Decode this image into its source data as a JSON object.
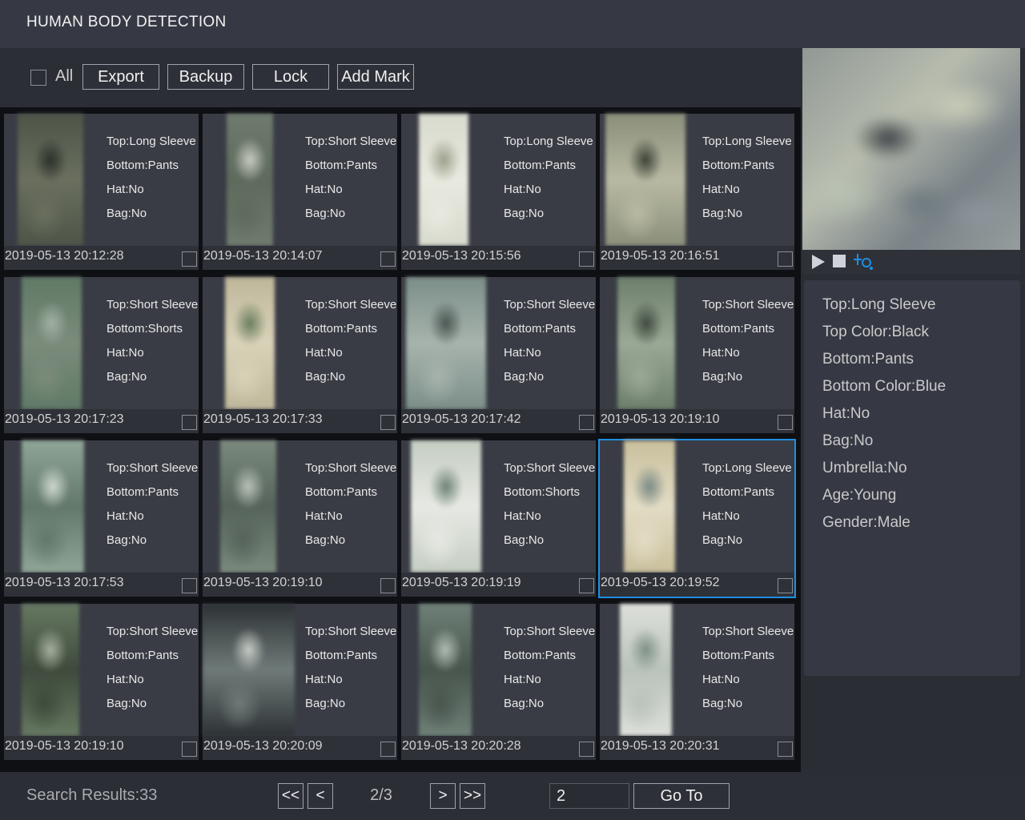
{
  "title": "HUMAN BODY DETECTION",
  "toolbar": {
    "all_label": "All",
    "export_label": "Export",
    "backup_label": "Backup",
    "lock_label": "Lock",
    "add_mark_label": "Add Mark"
  },
  "results": [
    {
      "top": "Top:Long Sleeve",
      "bottom": "Bottom:Pants",
      "hat": "Hat:No",
      "bag": "Bag:No",
      "time": "2019-05-13 20:12:28"
    },
    {
      "top": "Top:Short Sleeve",
      "bottom": "Bottom:Pants",
      "hat": "Hat:No",
      "bag": "Bag:No",
      "time": "2019-05-13 20:14:07"
    },
    {
      "top": "Top:Long Sleeve",
      "bottom": "Bottom:Pants",
      "hat": "Hat:No",
      "bag": "Bag:No",
      "time": "2019-05-13 20:15:56"
    },
    {
      "top": "Top:Long Sleeve",
      "bottom": "Bottom:Pants",
      "hat": "Hat:No",
      "bag": "Bag:No",
      "time": "2019-05-13 20:16:51"
    },
    {
      "top": "Top:Short Sleeve",
      "bottom": "Bottom:Shorts",
      "hat": "Hat:No",
      "bag": "Bag:No",
      "time": "2019-05-13 20:17:23"
    },
    {
      "top": "Top:Short Sleeve",
      "bottom": "Bottom:Pants",
      "hat": "Hat:No",
      "bag": "Bag:No",
      "time": "2019-05-13 20:17:33"
    },
    {
      "top": "Top:Short Sleeve",
      "bottom": "Bottom:Pants",
      "hat": "Hat:No",
      "bag": "Bag:No",
      "time": "2019-05-13 20:17:42"
    },
    {
      "top": "Top:Short Sleeve",
      "bottom": "Bottom:Pants",
      "hat": "Hat:No",
      "bag": "Bag:No",
      "time": "2019-05-13 20:19:10"
    },
    {
      "top": "Top:Short Sleeve",
      "bottom": "Bottom:Pants",
      "hat": "Hat:No",
      "bag": "Bag:No",
      "time": "2019-05-13 20:17:53"
    },
    {
      "top": "Top:Short Sleeve",
      "bottom": "Bottom:Pants",
      "hat": "Hat:No",
      "bag": "Bag:No",
      "time": "2019-05-13 20:19:10"
    },
    {
      "top": "Top:Short Sleeve",
      "bottom": "Bottom:Shorts",
      "hat": "Hat:No",
      "bag": "Bag:No",
      "time": "2019-05-13 20:19:19"
    },
    {
      "top": "Top:Long Sleeve",
      "bottom": "Bottom:Pants",
      "hat": "Hat:No",
      "bag": "Bag:No",
      "time": "2019-05-13 20:19:52",
      "selected": true
    },
    {
      "top": "Top:Short Sleeve",
      "bottom": "Bottom:Pants",
      "hat": "Hat:No",
      "bag": "Bag:No",
      "time": "2019-05-13 20:19:10"
    },
    {
      "top": "Top:Short Sleeve",
      "bottom": "Bottom:Pants",
      "hat": "Hat:No",
      "bag": "Bag:No",
      "time": "2019-05-13 20:20:09"
    },
    {
      "top": "Top:Short Sleeve",
      "bottom": "Bottom:Pants",
      "hat": "Hat:No",
      "bag": "Bag:No",
      "time": "2019-05-13 20:20:28"
    },
    {
      "top": "Top:Short Sleeve",
      "bottom": "Bottom:Pants",
      "hat": "Hat:No",
      "bag": "Bag:No",
      "time": "2019-05-13 20:20:31"
    }
  ],
  "preview": {
    "icons": [
      "play-icon",
      "stop-icon",
      "tracking-icon"
    ]
  },
  "detail": [
    "Top:Long Sleeve",
    "Top Color:Black",
    "Bottom:Pants",
    "Bottom Color:Blue",
    "Hat:No",
    "Bag:No",
    "Umbrella:No",
    "Age:Young",
    "Gender:Male"
  ],
  "statusbar": {
    "results_label": "Search Results:33",
    "first_label": "<<",
    "prev_label": "<",
    "page_label": "2/3",
    "next_label": ">",
    "last_label": ">>",
    "page_input_value": "2",
    "goto_label": "Go To"
  },
  "colors": {
    "selection": "#1e8fe1",
    "panel": "#3a3c45",
    "background": "#2b2d35"
  }
}
